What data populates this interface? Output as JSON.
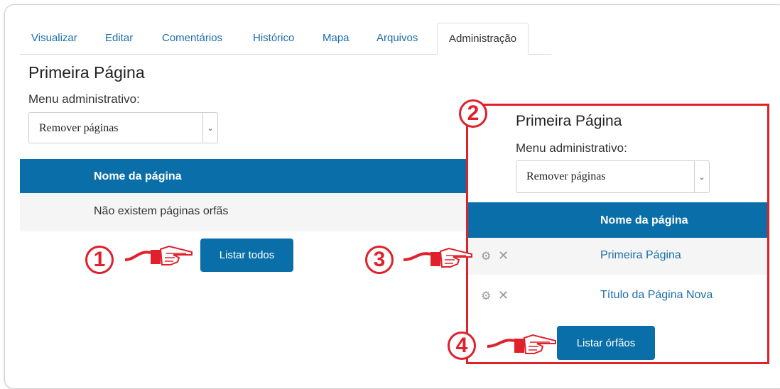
{
  "tabs": [
    "Visualizar",
    "Editar",
    "Comentários",
    "Histórico",
    "Mapa",
    "Arquivos",
    "Administração"
  ],
  "main": {
    "title": "Primeira Página",
    "menu_label": "Menu administrativo:",
    "select_value": "Remover páginas",
    "column_header": "Nome da página",
    "empty_message": "Não existem páginas orfãs",
    "list_all_button": "Listar todos"
  },
  "inset": {
    "title": "Primeira Página",
    "menu_label": "Menu administrativo:",
    "select_value": "Remover páginas",
    "column_header": "Nome da página",
    "rows": [
      "Primeira Página",
      "Título da Página Nova"
    ],
    "list_orphans_button": "Listar órfãos"
  },
  "callouts": [
    "1",
    "2",
    "3",
    "4"
  ],
  "colors": {
    "accent": "#0a6fa8",
    "callout": "#e0202a",
    "link": "#1a6ea8"
  },
  "icons": [
    "gear-icon",
    "close-icon",
    "pointing-hand-icon"
  ]
}
